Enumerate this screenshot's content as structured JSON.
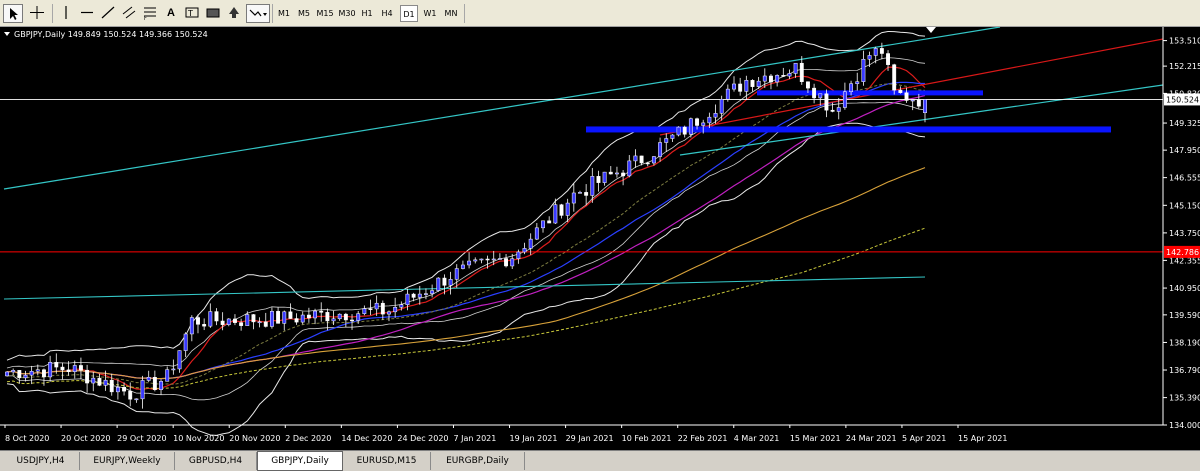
{
  "toolbar": {
    "timeframes": [
      "M1",
      "M5",
      "M15",
      "M30",
      "H1",
      "H4",
      "D1",
      "W1",
      "MN"
    ],
    "active_timeframe": "D1",
    "text_tool_label": "A"
  },
  "chart": {
    "header": "GBPJPY,Daily  149.849 150.524 149.366 150.524",
    "current_price": "150.524",
    "current_price_color": "#000000",
    "price_line_color": "#ffffff",
    "horizontal_line_label": "142.786",
    "horizontal_line_color": "#ff0000",
    "up_candle_color": "#3a3aff",
    "down_candle_color": "#ffffff",
    "y_ticks": [
      "153.510",
      "152.215",
      "150.830",
      "149.325",
      "147.950",
      "146.555",
      "145.150",
      "143.750",
      "142.355",
      "140.950",
      "139.590",
      "138.190",
      "136.790",
      "135.390",
      "134.000"
    ],
    "x_ticks": [
      "8 Oct 2020",
      "20 Oct 2020",
      "29 Oct 2020",
      "10 Nov 2020",
      "20 Nov 2020",
      "2 Dec 2020",
      "14 Dec 2020",
      "24 Dec 2020",
      "7 Jan 2021",
      "19 Jan 2021",
      "29 Jan 2021",
      "10 Feb 2021",
      "22 Feb 2021",
      "4 Mar 2021",
      "15 Mar 2021",
      "24 Mar 2021",
      "5 Apr 2021",
      "15 Apr 2021"
    ]
  },
  "tabs": [
    "USDJPY,H4",
    "EURJPY,Weekly",
    "GBPUSD,H4",
    "GBPJPY,Daily",
    "EURUSD,M15",
    "EURGBP,Daily"
  ],
  "active_tab": "GBPJPY,Daily"
}
